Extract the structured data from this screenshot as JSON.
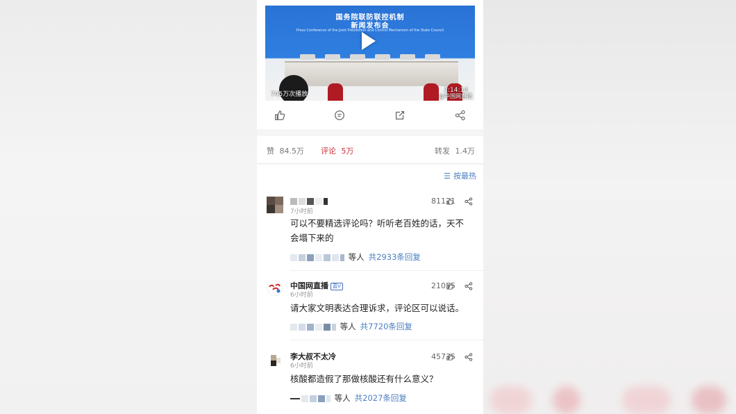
{
  "video": {
    "banner_title_1": "国务院联防联控机制",
    "banner_title_2": "新闻发布会",
    "banner_en": "Press Conference of the Joint Prevention and Control Mechanism of the State Council",
    "views": "745万次播放",
    "duration": "2:14:14",
    "watermark": "@中国网直播"
  },
  "actions": {
    "like_icon": "thumbs-up-icon",
    "comment_icon": "comment-icon",
    "repost_icon": "repost-icon",
    "share_icon": "share-icon"
  },
  "stats": {
    "like_label": "赞",
    "like_count": "84.5万",
    "comment_label": "评论",
    "comment_count": "5万",
    "repost_label": "转发",
    "repost_count": "1.4万",
    "active_color": "#c8313a"
  },
  "sort": {
    "label": "按最热"
  },
  "comments": [
    {
      "name": "",
      "time": "7小时前",
      "likes": "81121",
      "text": "可以不要精选评论吗？听听老百姓的话，天不会塌下来的",
      "reply_suffix": "等人",
      "reply_count": "共2933条回复"
    },
    {
      "name": "中国网直播",
      "badge": "蓝V",
      "time": "6小时前",
      "likes": "21055",
      "text": "请大家文明表达合理诉求，评论区可以说话。",
      "reply_suffix": "等人",
      "reply_count": "共7720条回复"
    },
    {
      "name": "李大叔不太冷",
      "time": "6小时前",
      "likes": "45735",
      "text": "核酸都造假了那做核酸还有什么意义？",
      "reply_suffix": "等人",
      "reply_count": "共2027条回复"
    }
  ]
}
